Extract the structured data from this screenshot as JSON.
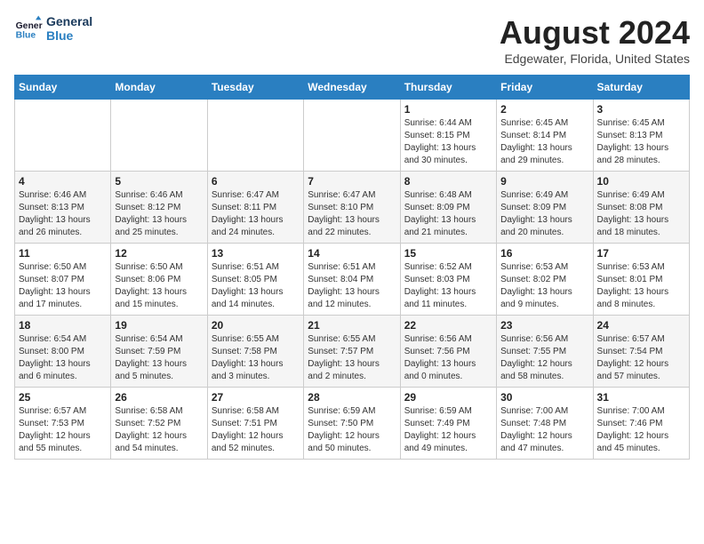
{
  "logo": {
    "line1": "General",
    "line2": "Blue"
  },
  "title": "August 2024",
  "location": "Edgewater, Florida, United States",
  "weekdays": [
    "Sunday",
    "Monday",
    "Tuesday",
    "Wednesday",
    "Thursday",
    "Friday",
    "Saturday"
  ],
  "weeks": [
    [
      {
        "day": "",
        "info": ""
      },
      {
        "day": "",
        "info": ""
      },
      {
        "day": "",
        "info": ""
      },
      {
        "day": "",
        "info": ""
      },
      {
        "day": "1",
        "info": "Sunrise: 6:44 AM\nSunset: 8:15 PM\nDaylight: 13 hours\nand 30 minutes."
      },
      {
        "day": "2",
        "info": "Sunrise: 6:45 AM\nSunset: 8:14 PM\nDaylight: 13 hours\nand 29 minutes."
      },
      {
        "day": "3",
        "info": "Sunrise: 6:45 AM\nSunset: 8:13 PM\nDaylight: 13 hours\nand 28 minutes."
      }
    ],
    [
      {
        "day": "4",
        "info": "Sunrise: 6:46 AM\nSunset: 8:13 PM\nDaylight: 13 hours\nand 26 minutes."
      },
      {
        "day": "5",
        "info": "Sunrise: 6:46 AM\nSunset: 8:12 PM\nDaylight: 13 hours\nand 25 minutes."
      },
      {
        "day": "6",
        "info": "Sunrise: 6:47 AM\nSunset: 8:11 PM\nDaylight: 13 hours\nand 24 minutes."
      },
      {
        "day": "7",
        "info": "Sunrise: 6:47 AM\nSunset: 8:10 PM\nDaylight: 13 hours\nand 22 minutes."
      },
      {
        "day": "8",
        "info": "Sunrise: 6:48 AM\nSunset: 8:09 PM\nDaylight: 13 hours\nand 21 minutes."
      },
      {
        "day": "9",
        "info": "Sunrise: 6:49 AM\nSunset: 8:09 PM\nDaylight: 13 hours\nand 20 minutes."
      },
      {
        "day": "10",
        "info": "Sunrise: 6:49 AM\nSunset: 8:08 PM\nDaylight: 13 hours\nand 18 minutes."
      }
    ],
    [
      {
        "day": "11",
        "info": "Sunrise: 6:50 AM\nSunset: 8:07 PM\nDaylight: 13 hours\nand 17 minutes."
      },
      {
        "day": "12",
        "info": "Sunrise: 6:50 AM\nSunset: 8:06 PM\nDaylight: 13 hours\nand 15 minutes."
      },
      {
        "day": "13",
        "info": "Sunrise: 6:51 AM\nSunset: 8:05 PM\nDaylight: 13 hours\nand 14 minutes."
      },
      {
        "day": "14",
        "info": "Sunrise: 6:51 AM\nSunset: 8:04 PM\nDaylight: 13 hours\nand 12 minutes."
      },
      {
        "day": "15",
        "info": "Sunrise: 6:52 AM\nSunset: 8:03 PM\nDaylight: 13 hours\nand 11 minutes."
      },
      {
        "day": "16",
        "info": "Sunrise: 6:53 AM\nSunset: 8:02 PM\nDaylight: 13 hours\nand 9 minutes."
      },
      {
        "day": "17",
        "info": "Sunrise: 6:53 AM\nSunset: 8:01 PM\nDaylight: 13 hours\nand 8 minutes."
      }
    ],
    [
      {
        "day": "18",
        "info": "Sunrise: 6:54 AM\nSunset: 8:00 PM\nDaylight: 13 hours\nand 6 minutes."
      },
      {
        "day": "19",
        "info": "Sunrise: 6:54 AM\nSunset: 7:59 PM\nDaylight: 13 hours\nand 5 minutes."
      },
      {
        "day": "20",
        "info": "Sunrise: 6:55 AM\nSunset: 7:58 PM\nDaylight: 13 hours\nand 3 minutes."
      },
      {
        "day": "21",
        "info": "Sunrise: 6:55 AM\nSunset: 7:57 PM\nDaylight: 13 hours\nand 2 minutes."
      },
      {
        "day": "22",
        "info": "Sunrise: 6:56 AM\nSunset: 7:56 PM\nDaylight: 13 hours\nand 0 minutes."
      },
      {
        "day": "23",
        "info": "Sunrise: 6:56 AM\nSunset: 7:55 PM\nDaylight: 12 hours\nand 58 minutes."
      },
      {
        "day": "24",
        "info": "Sunrise: 6:57 AM\nSunset: 7:54 PM\nDaylight: 12 hours\nand 57 minutes."
      }
    ],
    [
      {
        "day": "25",
        "info": "Sunrise: 6:57 AM\nSunset: 7:53 PM\nDaylight: 12 hours\nand 55 minutes."
      },
      {
        "day": "26",
        "info": "Sunrise: 6:58 AM\nSunset: 7:52 PM\nDaylight: 12 hours\nand 54 minutes."
      },
      {
        "day": "27",
        "info": "Sunrise: 6:58 AM\nSunset: 7:51 PM\nDaylight: 12 hours\nand 52 minutes."
      },
      {
        "day": "28",
        "info": "Sunrise: 6:59 AM\nSunset: 7:50 PM\nDaylight: 12 hours\nand 50 minutes."
      },
      {
        "day": "29",
        "info": "Sunrise: 6:59 AM\nSunset: 7:49 PM\nDaylight: 12 hours\nand 49 minutes."
      },
      {
        "day": "30",
        "info": "Sunrise: 7:00 AM\nSunset: 7:48 PM\nDaylight: 12 hours\nand 47 minutes."
      },
      {
        "day": "31",
        "info": "Sunrise: 7:00 AM\nSunset: 7:46 PM\nDaylight: 12 hours\nand 45 minutes."
      }
    ]
  ]
}
